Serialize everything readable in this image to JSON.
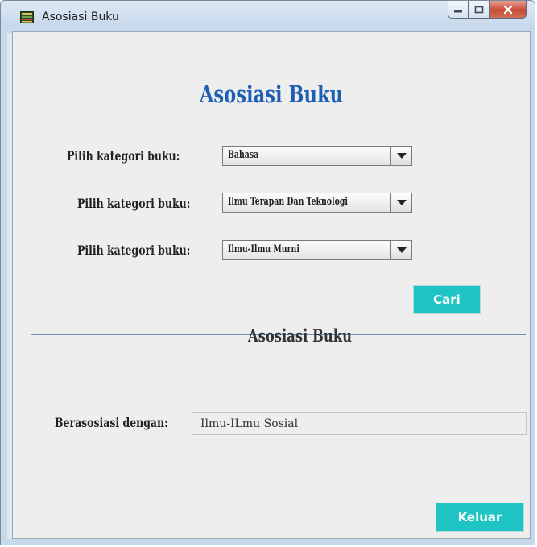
{
  "window": {
    "title": "Asosiasi Buku"
  },
  "form": {
    "heading": "Asosiasi Buku",
    "rows": [
      {
        "label": "Pilih kategori buku:",
        "value": "Bahasa"
      },
      {
        "label": "Pilih kategori buku:",
        "value": "Ilmu Terapan Dan Teknologi"
      },
      {
        "label": "Pilih kategori buku:",
        "value": "Ilmu-Ilmu Murni"
      }
    ],
    "search_label": "Cari"
  },
  "result": {
    "heading": "Asosiasi Buku",
    "label": "Berasosiasi dengan:",
    "value": "Ilmu-ILmu Sosial"
  },
  "exit_label": "Keluar",
  "colors": {
    "heading_blue": "#1e5fb3",
    "button_teal": "#1fc4c4",
    "client_bg": "#eeeeee"
  }
}
